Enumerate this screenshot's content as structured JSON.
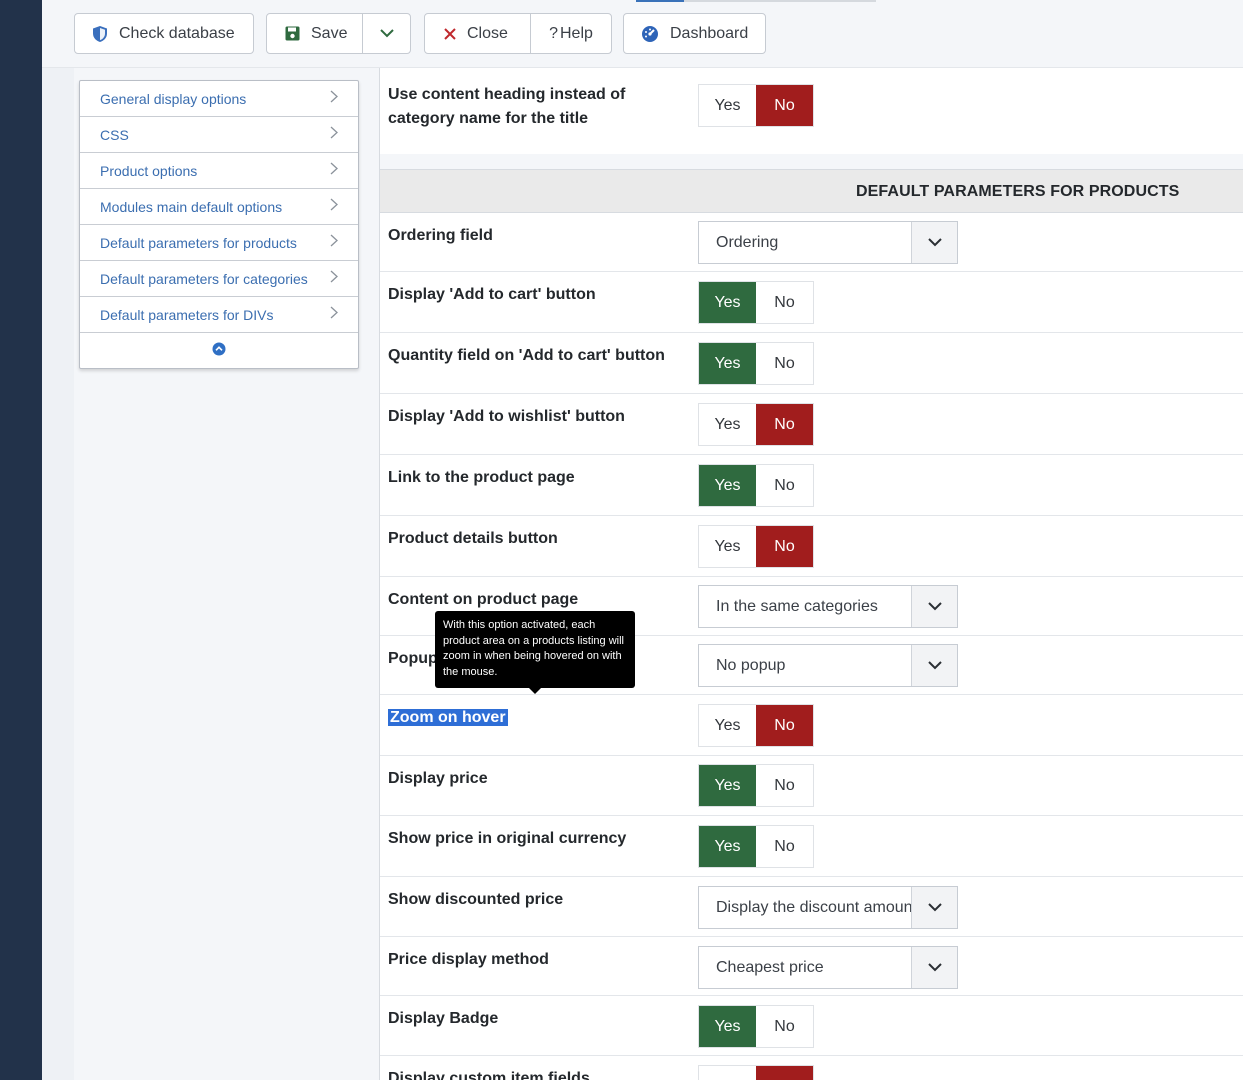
{
  "toolbar": {
    "check_database": "Check database",
    "save": "Save",
    "close": "Close",
    "help": "Help",
    "help_prefix": "?",
    "dashboard": "Dashboard"
  },
  "sidebar": {
    "items": [
      {
        "label": "General display options"
      },
      {
        "label": "CSS"
      },
      {
        "label": "Product options"
      },
      {
        "label": "Modules main default options"
      },
      {
        "label": "Default parameters for products"
      },
      {
        "label": "Default parameters for categories"
      },
      {
        "label": "Default parameters for DIVs"
      }
    ]
  },
  "top_row": {
    "label_line1": "Use content heading instead of",
    "label_line2": "category name for the title",
    "yes": "Yes",
    "no": "No",
    "selected": "No"
  },
  "section": {
    "title": "DEFAULT PARAMETERS FOR PRODUCTS"
  },
  "rows": [
    {
      "label": "Ordering field",
      "type": "select",
      "value": "Ordering"
    },
    {
      "label": "Display 'Add to cart' button",
      "type": "toggle",
      "selected": "Yes"
    },
    {
      "label": "Quantity field on 'Add to cart' button",
      "type": "toggle",
      "selected": "Yes"
    },
    {
      "label": "Display 'Add to wishlist' button",
      "type": "toggle",
      "selected": "No"
    },
    {
      "label": "Link to the product page",
      "type": "toggle",
      "selected": "Yes"
    },
    {
      "label": "Product details button",
      "type": "toggle",
      "selected": "No"
    },
    {
      "label": "Content on product page",
      "type": "select",
      "value": "In the same categories"
    },
    {
      "label": "Popup",
      "type": "select",
      "value": "No popup"
    },
    {
      "label": "Zoom on hover",
      "type": "toggle",
      "selected": "No"
    },
    {
      "label": "Display price",
      "type": "toggle",
      "selected": "Yes"
    },
    {
      "label": "Show price in original currency",
      "type": "toggle",
      "selected": "Yes"
    },
    {
      "label": "Show discounted price",
      "type": "select",
      "value": "Display the discount amount"
    },
    {
      "label": "Price display method",
      "type": "select",
      "value": "Cheapest price"
    },
    {
      "label": "Display Badge",
      "type": "toggle",
      "selected": "Yes"
    },
    {
      "label": "Display custom item fields",
      "type": "toggle",
      "selected": "No"
    }
  ],
  "toggle_labels": {
    "yes": "Yes",
    "no": "No"
  },
  "tooltip": {
    "text": "With this option activated, each product area on a products listing will zoom in when being hovered on with the mouse."
  },
  "colors": {
    "yes_active": "#2f6a3f",
    "no_active": "#a11d1d",
    "link": "#3b6eb0",
    "sidebar_dark": "#22324a",
    "selection": "#2e6ed6"
  },
  "icons": {
    "check_database": "shield-icon",
    "save": "floppy-disk-icon",
    "save_dropdown": "chevron-down-icon",
    "close": "x-icon",
    "dashboard": "dashboard-gauge-icon",
    "sidebar_item": "chevron-right-icon",
    "sidebar_collapse": "chevron-up-circle-icon",
    "select_arrow": "chevron-down-icon"
  }
}
